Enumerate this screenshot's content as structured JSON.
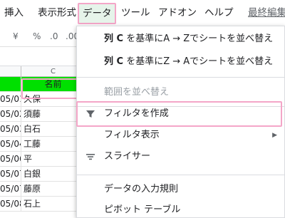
{
  "menubar": {
    "items": [
      {
        "label": "挿入"
      },
      {
        "label": "表示形式"
      },
      {
        "label": "データ"
      },
      {
        "label": "ツール"
      },
      {
        "label": "アドオン"
      },
      {
        "label": "ヘルプ"
      },
      {
        "label": "最終編集"
      }
    ]
  },
  "toolbar": {
    "currency": "¥",
    "percent": "%",
    "dec_less": ".0",
    "dec_more": ".00"
  },
  "grid": {
    "column_header": "C",
    "header_cell": "名前",
    "rows": [
      {
        "date": "05/01",
        "name": "久保"
      },
      {
        "date": "05/02",
        "name": "須藤"
      },
      {
        "date": "05/03",
        "name": "白石"
      },
      {
        "date": "05/04",
        "name": "工藤"
      },
      {
        "date": "05/06",
        "name": "平"
      },
      {
        "date": "05/07",
        "name": "白銀"
      },
      {
        "date": "05/07",
        "name": "藤原"
      },
      {
        "date": "05/08",
        "name": "石上"
      }
    ]
  },
  "dropdown": {
    "sort_az_col": "列 C",
    "sort_az_rest": " を基準にA → Zでシートを並べ替え",
    "sort_za_col": "列 C",
    "sort_za_rest": " を基準にZ → Aでシートを並べ替え",
    "sort_range": "範囲を並べ替え",
    "create_filter": "フィルタを作成",
    "filter_views": "フィルタ表示",
    "slicer": "スライサー",
    "data_validation": "データの入力規則",
    "pivot_table": "ピボット テーブル"
  },
  "colors": {
    "accent_highlight": "#f4a6c8",
    "header_fill": "#00e000",
    "active_menu_bg": "#e6f4ea"
  }
}
